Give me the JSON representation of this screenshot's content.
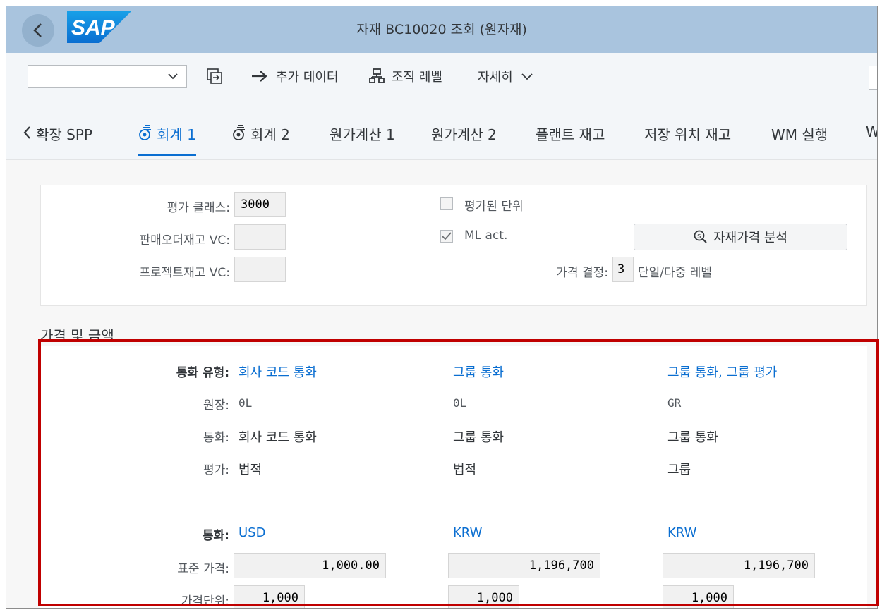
{
  "shell": {
    "logo_text": "SAP",
    "title": "자재 BC10020 조회 (원자재)"
  },
  "toolbar": {
    "select_value": "",
    "extra_data": "추가 데이터",
    "org_levels": "조직 레벨",
    "more": "자세히"
  },
  "tabs": [
    {
      "label": "확장 SPP"
    },
    {
      "label": "회계 1"
    },
    {
      "label": "회계 2"
    },
    {
      "label": "원가계산 1"
    },
    {
      "label": "원가계산 2"
    },
    {
      "label": "플랜트 재고"
    },
    {
      "label": "저장 위치 재고"
    },
    {
      "label": "WM 실행"
    },
    {
      "label": "W"
    }
  ],
  "general": {
    "valuation_class_label": "평가 클래스:",
    "valuation_class_value": "3000",
    "so_stock_vc_label": "판매오더재고 VC:",
    "so_stock_vc_value": "",
    "project_stock_vc_label": "프로젝트재고 VC:",
    "project_stock_vc_value": "",
    "valuated_unit_label": "평가된 단위",
    "valuated_unit_checked": false,
    "ml_act_label": "ML act.",
    "ml_act_checked": true,
    "price_analysis_button": "자재가격 분석",
    "price_determination_label": "가격 결정:",
    "price_determination_value": "3",
    "price_determination_text": "단일/다중 레벨"
  },
  "prices": {
    "title": "가격 및 금액",
    "labels": {
      "currency_type": "통화 유형:",
      "ledger": "원장:",
      "currency": "통화:",
      "valuation": "평가:",
      "currency2": "통화:",
      "standard_price": "표준 가격:",
      "price_unit": "가격단위:"
    },
    "columns": [
      {
        "currency_type": "회사 코드 통화",
        "ledger": "0L",
        "currency": "회사 코드 통화",
        "valuation": "법적",
        "currency_code": "USD",
        "standard_price": "1,000.00",
        "price_unit": "1,000"
      },
      {
        "currency_type": "그룹 통화",
        "ledger": "0L",
        "currency": "그룹 통화",
        "valuation": "법적",
        "currency_code": "KRW",
        "standard_price": "1,196,700",
        "price_unit": "1,000"
      },
      {
        "currency_type": "그룹 통화, 그룹 평가",
        "ledger": "GR",
        "currency": "그룹 통화",
        "valuation": "그룹",
        "currency_code": "KRW",
        "standard_price": "1,196,700",
        "price_unit": "1,000"
      }
    ]
  },
  "colors": {
    "shell_bg": "#a9c4de",
    "link": "#0a6ed1",
    "highlight": "#c00000"
  }
}
